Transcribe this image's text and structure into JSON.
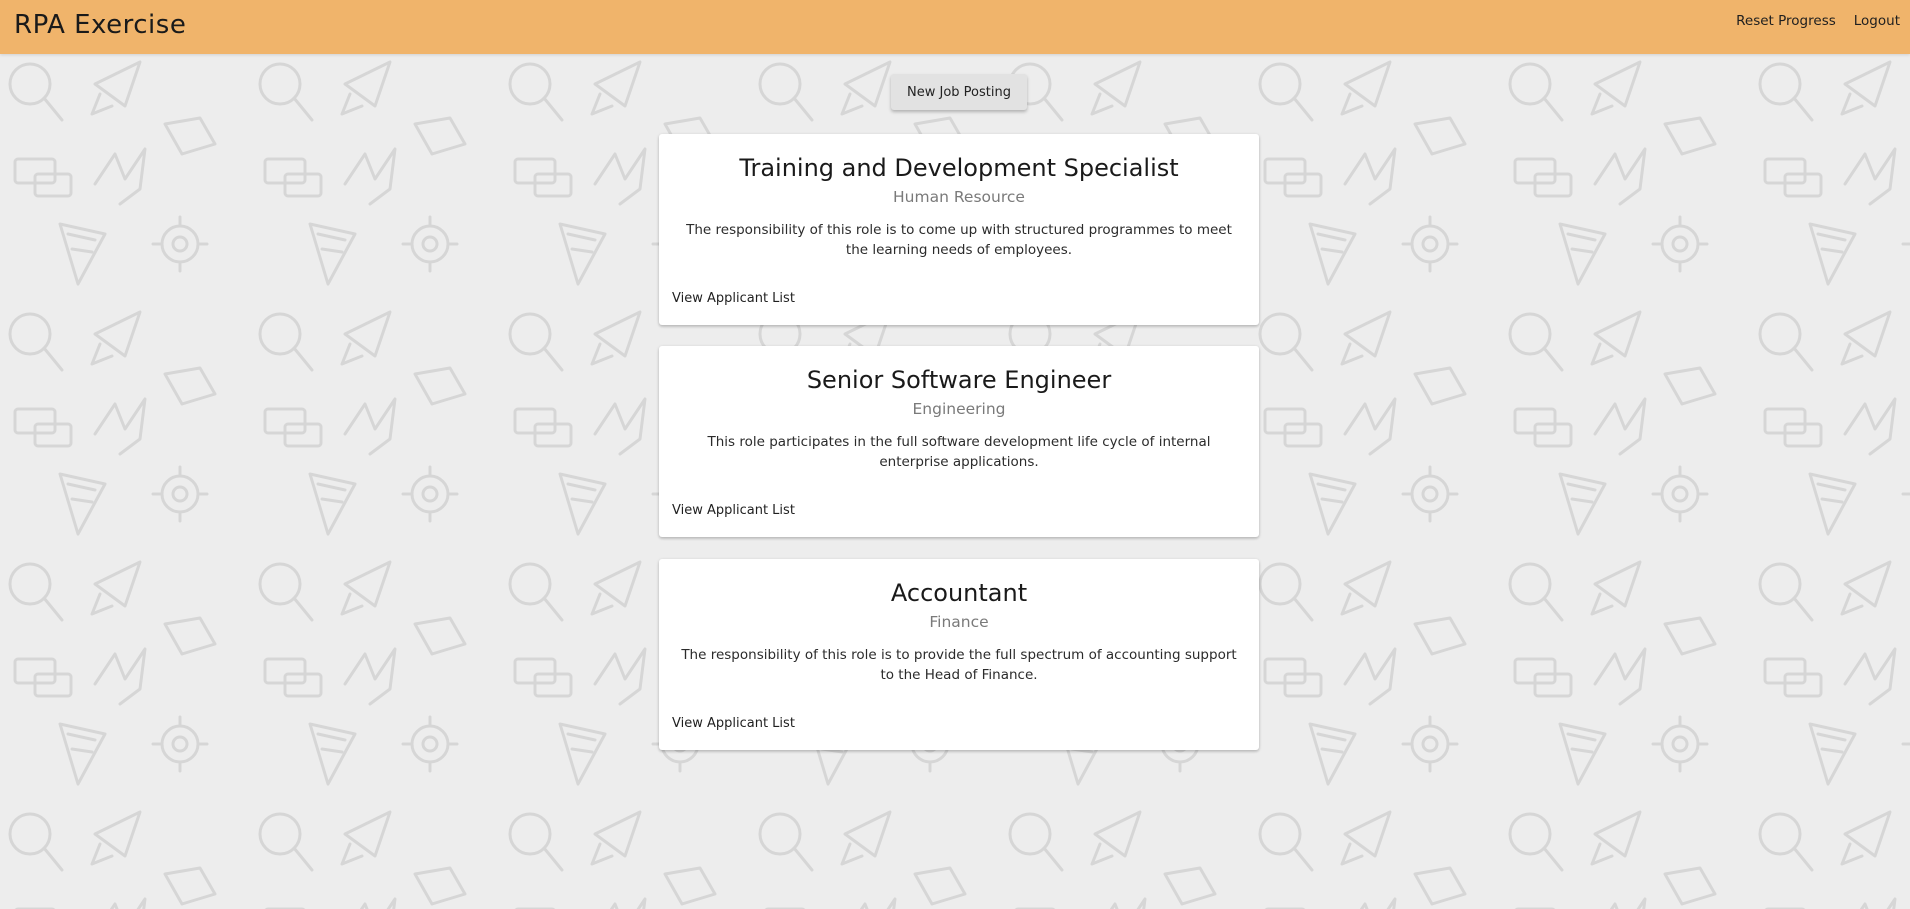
{
  "header": {
    "title": "RPA Exercise",
    "nav": [
      {
        "label": "Reset Progress"
      },
      {
        "label": "Logout"
      }
    ]
  },
  "actions": {
    "new_job_label": "New Job Posting"
  },
  "jobs": [
    {
      "title": "Training and Development Specialist",
      "department": "Human Resource",
      "description": "The responsibility of this role is to come up with structured programmes to meet the learning needs of employees.",
      "link_label": "View Applicant List"
    },
    {
      "title": "Senior Software Engineer",
      "department": "Engineering",
      "description": "This role participates in the full software development life cycle of internal enterprise applications.",
      "link_label": "View Applicant List"
    },
    {
      "title": "Accountant",
      "department": "Finance",
      "description": "The responsibility of this role is to provide the full spectrum of accounting support to the Head of Finance.",
      "link_label": "View Applicant List"
    }
  ],
  "colors": {
    "header_bg": "#f0b46b",
    "page_bg": "#ededed",
    "pattern": "#d9d9d9"
  }
}
